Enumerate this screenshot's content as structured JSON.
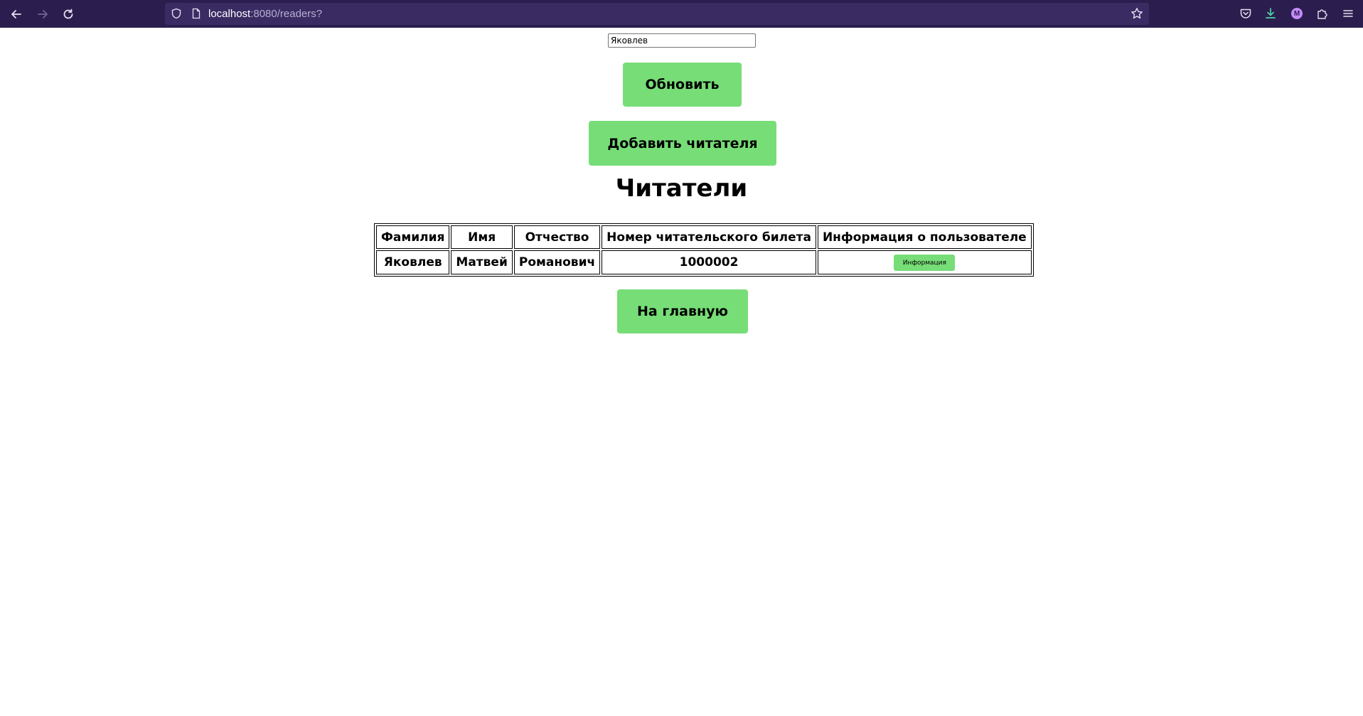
{
  "browser": {
    "url_host": "localhost",
    "url_path": ":8080/readers?"
  },
  "search": {
    "value": "Яковлев"
  },
  "buttons": {
    "refresh": "Обновить",
    "add_reader": "Добавить читателя",
    "home": "На главную"
  },
  "heading": "Читатели",
  "table": {
    "headers": [
      "Фамилия",
      "Имя",
      "Отчество",
      "Номер читательского билета",
      "Информация о пользователе"
    ],
    "rows": [
      {
        "last_name": "Яковлев",
        "first_name": "Матвей",
        "patronymic": "Романович",
        "card_number": "1000002",
        "info_button": "Информация"
      }
    ]
  },
  "colors": {
    "chrome": "#2b1e4e",
    "button_green": "#77dd77"
  }
}
